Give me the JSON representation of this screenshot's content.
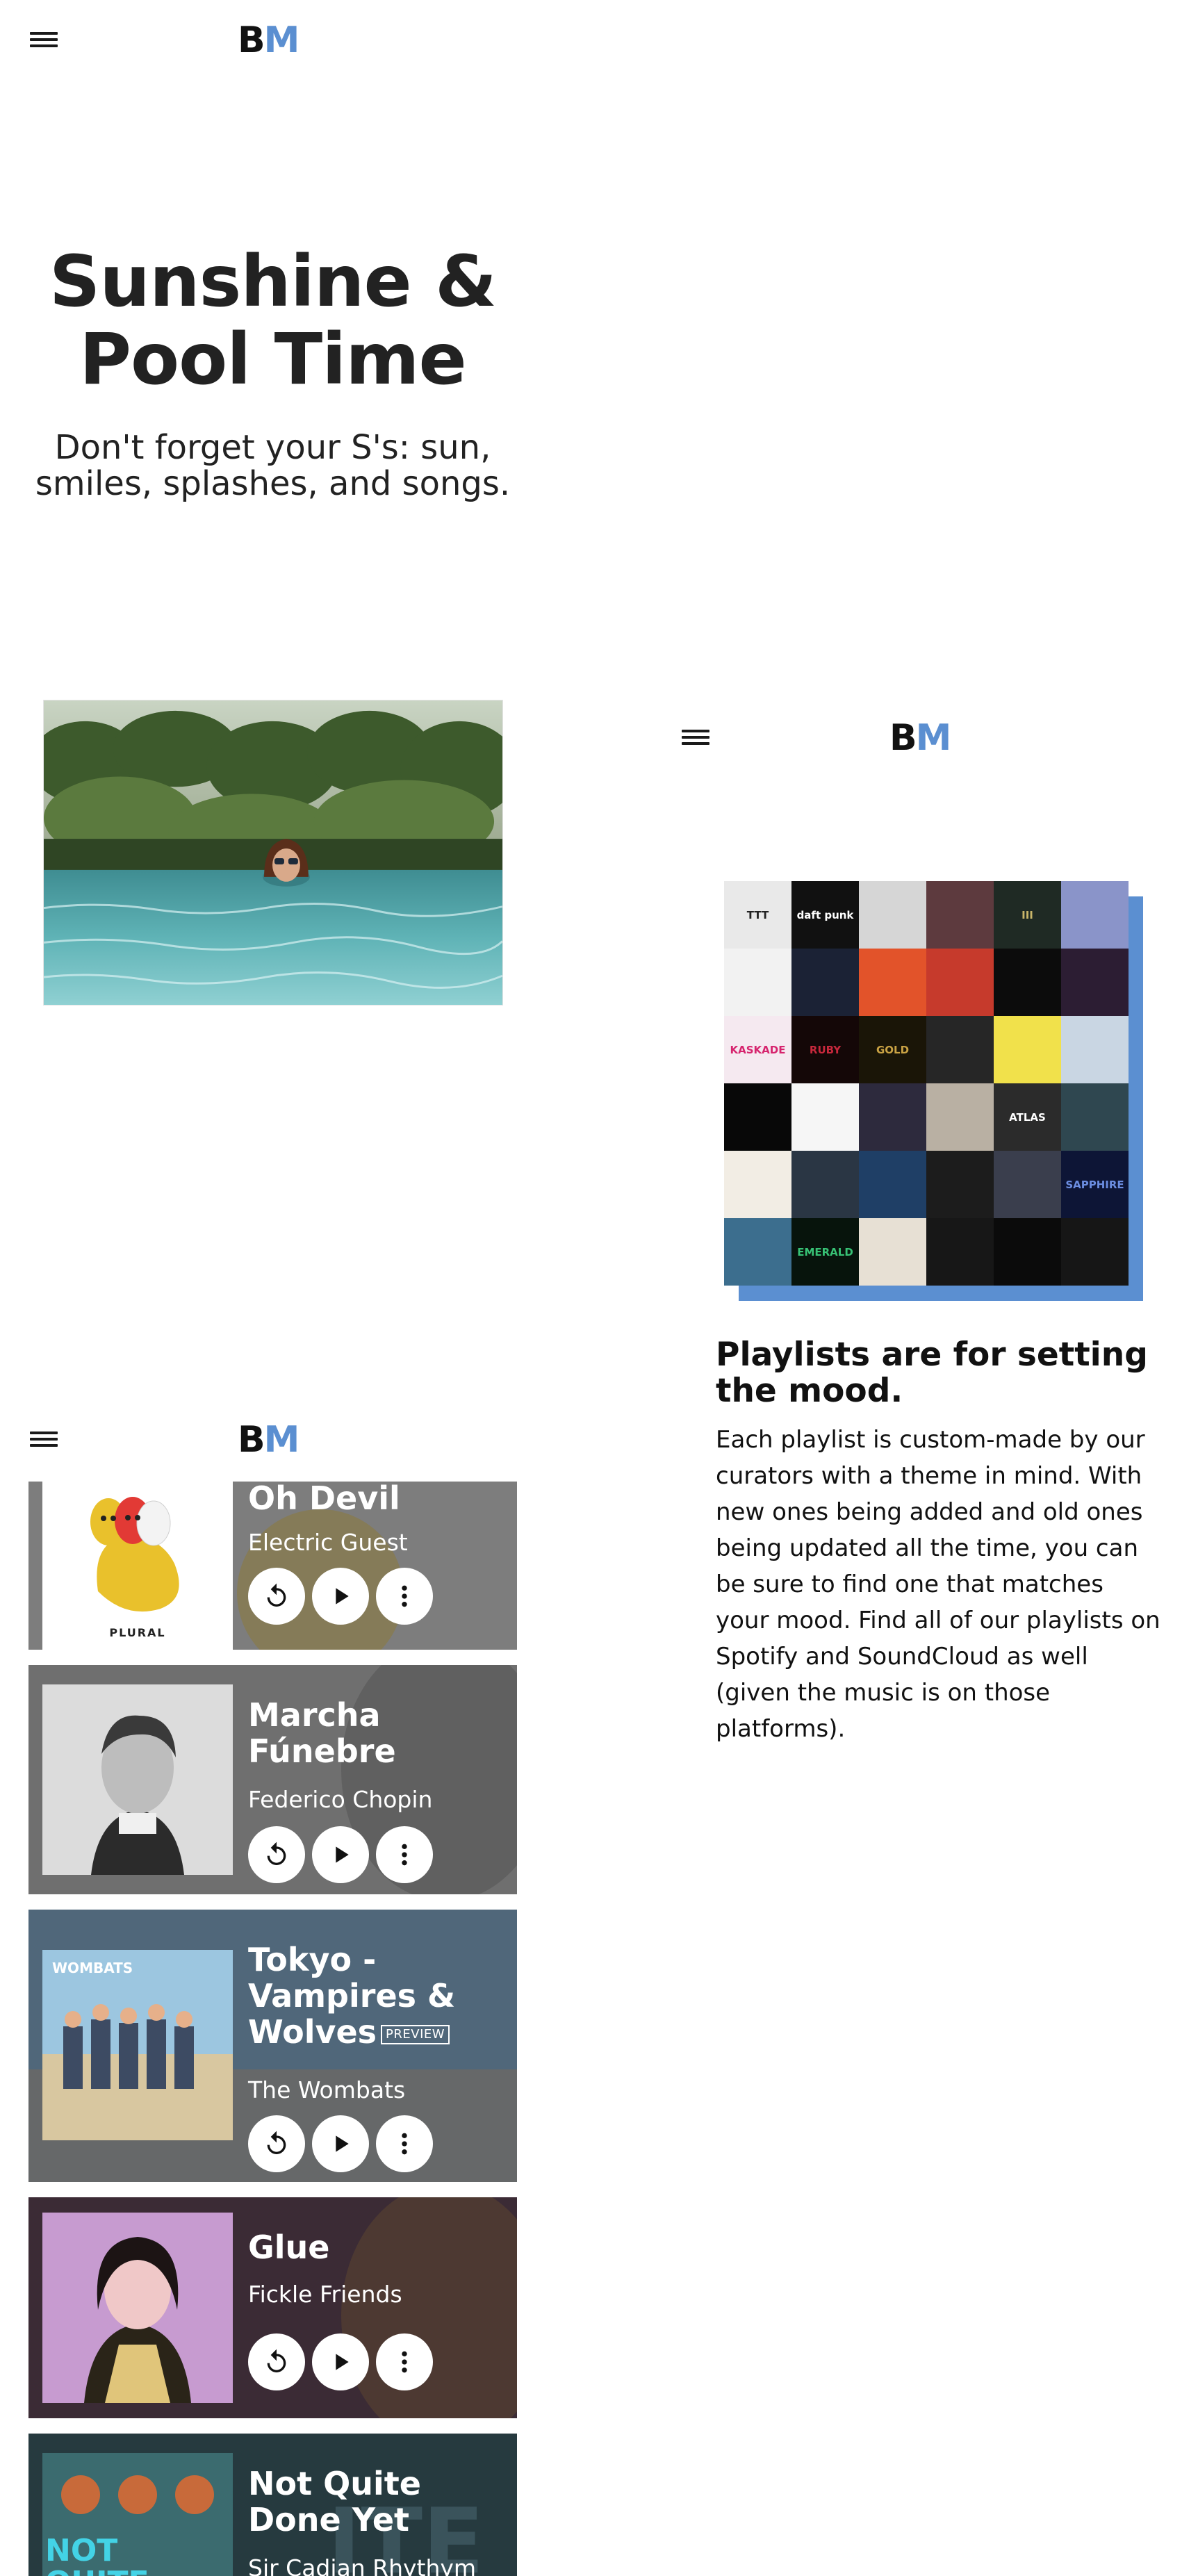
{
  "screens": [
    {
      "header": {
        "logo_b": "B",
        "logo_m": "M"
      },
      "hero": {
        "title": "Sunshine & Pool Time",
        "subtitle": "Don't forget your S's: sun, smiles, splashes, and songs."
      }
    },
    {
      "header": {
        "logo_b": "B",
        "logo_m": "M"
      },
      "album_grid": {
        "covers": [
          {
            "text": "TTT",
            "bg": "#e9e9e9",
            "fg": "#222222"
          },
          {
            "text": "daft punk",
            "bg": "#111111",
            "fg": "#ffffff"
          },
          {
            "text": "",
            "bg": "#d6d6d6",
            "fg": "#222222"
          },
          {
            "text": "",
            "bg": "#5d3a3e",
            "fg": "#ffffff"
          },
          {
            "text": "III",
            "bg": "#1f2a24",
            "fg": "#c9b66a"
          },
          {
            "text": "",
            "bg": "#8a94c9",
            "fg": "#ffffff"
          },
          {
            "text": "",
            "bg": "#f2f2f2",
            "fg": "#222222"
          },
          {
            "text": "",
            "bg": "#1b2235",
            "fg": "#d23a3a"
          },
          {
            "text": "",
            "bg": "#e2532a",
            "fg": "#111111"
          },
          {
            "text": "",
            "bg": "#c63a2c",
            "fg": "#ffffff"
          },
          {
            "text": "",
            "bg": "#0c0c0c",
            "fg": "#b59a3b"
          },
          {
            "text": "",
            "bg": "#2c1d33",
            "fg": "#d88ad0"
          },
          {
            "text": "KASKADE",
            "bg": "#f5e9f0",
            "fg": "#d6246e"
          },
          {
            "text": "RUBY",
            "bg": "#140707",
            "fg": "#c8283c"
          },
          {
            "text": "GOLD",
            "bg": "#1a1507",
            "fg": "#c9a244"
          },
          {
            "text": "",
            "bg": "#262626",
            "fg": "#ffffff"
          },
          {
            "text": "",
            "bg": "#f1e14b",
            "fg": "#c3223a"
          },
          {
            "text": "",
            "bg": "#c9d6e3",
            "fg": "#222222"
          },
          {
            "text": "",
            "bg": "#080808",
            "fg": "#d9c46a"
          },
          {
            "text": "",
            "bg": "#f6f6f6",
            "fg": "#d32f2f"
          },
          {
            "text": "",
            "bg": "#2d2a3d",
            "fg": "#ffffff"
          },
          {
            "text": "",
            "bg": "#b9b0a3",
            "fg": "#ffffff"
          },
          {
            "text": "ATLAS",
            "bg": "#2b2b2b",
            "fg": "#ffffff"
          },
          {
            "text": "",
            "bg": "#2f4750",
            "fg": "#ffffff"
          },
          {
            "text": "",
            "bg": "#f2ede4",
            "fg": "#c58b2a"
          },
          {
            "text": "",
            "bg": "#2a3644",
            "fg": "#e04b3a"
          },
          {
            "text": "",
            "bg": "#1f3f66",
            "fg": "#ffffff"
          },
          {
            "text": "",
            "bg": "#1c1c1c",
            "fg": "#ffffff"
          },
          {
            "text": "",
            "bg": "#3a3e4d",
            "fg": "#ffffff"
          },
          {
            "text": "SAPPHIRE",
            "bg": "#0d1536",
            "fg": "#6b8de0"
          },
          {
            "text": "",
            "bg": "#3c6e8e",
            "fg": "#ffffff"
          },
          {
            "text": "EMERALD",
            "bg": "#07140c",
            "fg": "#37c275"
          },
          {
            "text": "",
            "bg": "#e7e0d4",
            "fg": "#222222"
          },
          {
            "text": "",
            "bg": "#171717",
            "fg": "#d94aa0"
          },
          {
            "text": "",
            "bg": "#0b0b0b",
            "fg": "#e0a52a"
          },
          {
            "text": "",
            "bg": "#161616",
            "fg": "#c32c2c"
          }
        ]
      },
      "heading": "Playlists are for setting the mood.",
      "body": "Each playlist is custom-made by our curators with a theme in mind. With new ones being added and old ones being updated all the time, you can be sure to find one that matches your mood. Find all of our playlists on Spotify and SoundCloud as well (given the music is on those platforms)."
    },
    {
      "header": {
        "logo_b": "B",
        "logo_m": "M"
      },
      "tracks": [
        {
          "title": "Oh Devil",
          "artist": "Electric Guest",
          "art_label": "PLURAL",
          "badge": ""
        },
        {
          "title": "Marcha Fúnebre",
          "artist": "Federico Chopin",
          "art_label": "",
          "badge": ""
        },
        {
          "title": "Tokyo - Vampires & Wolves",
          "artist": "The Wombats",
          "art_label": "WOMBATS",
          "badge": "PREVIEW"
        },
        {
          "title": "Glue",
          "artist": "Fickle Friends",
          "art_label": "",
          "badge": ""
        },
        {
          "title": "Not Quite Done Yet",
          "artist": "Sir Cadian Rhythym",
          "art_label": "NOT QUITE DONE YET",
          "badge": ""
        }
      ]
    }
  ],
  "colors": {
    "brand_blue": "#5b8fd1",
    "ink": "#1a1a1a"
  },
  "icons": [
    "menu-icon",
    "replay-icon",
    "play-icon",
    "more-vertical-icon"
  ]
}
